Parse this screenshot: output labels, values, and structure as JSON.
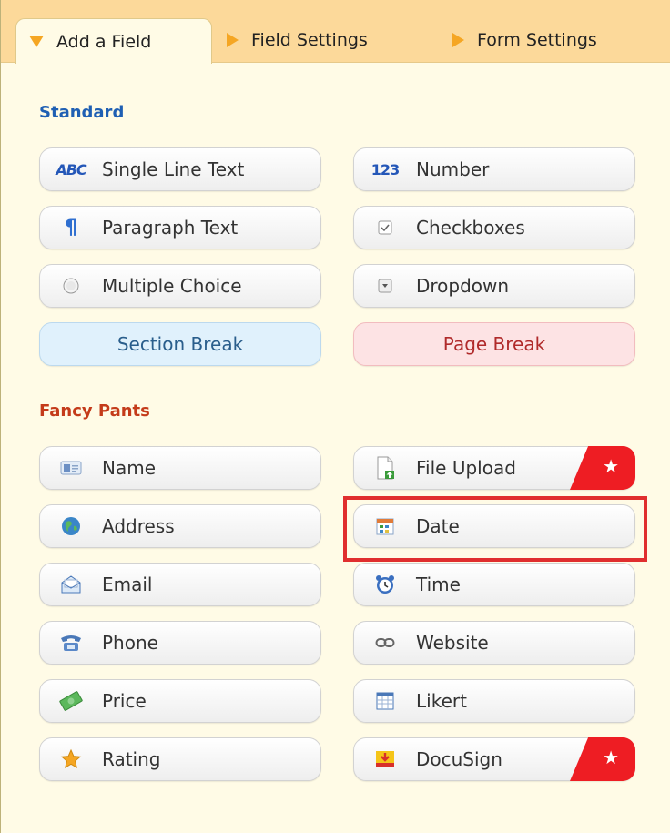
{
  "tabs": [
    {
      "label": "Add a Field",
      "active": true
    },
    {
      "label": "Field Settings",
      "active": false
    },
    {
      "label": "Form Settings",
      "active": false
    }
  ],
  "sections": {
    "standard": "Standard",
    "fancy": "Fancy Pants"
  },
  "standard_fields": {
    "single_line_text": "Single Line Text",
    "number": "Number",
    "paragraph_text": "Paragraph Text",
    "checkboxes": "Checkboxes",
    "multiple_choice": "Multiple Choice",
    "dropdown": "Dropdown",
    "section_break": "Section Break",
    "page_break": "Page Break"
  },
  "fancy_fields": {
    "name": "Name",
    "file_upload": "File Upload",
    "address": "Address",
    "date": "Date",
    "email": "Email",
    "time": "Time",
    "phone": "Phone",
    "website": "Website",
    "price": "Price",
    "likert": "Likert",
    "rating": "Rating",
    "docusign": "DocuSign"
  },
  "icons": {
    "abc": "ABC",
    "num": "123",
    "star": "★"
  },
  "colors": {
    "accent": "#f5a623",
    "tab_bar": "#fcd99a",
    "background": "#fffbe6",
    "standard_title": "#1f5fb3",
    "fancy_title": "#c43b1a",
    "premium_badge": "#ee1d23",
    "highlight": "#e02e2e"
  }
}
